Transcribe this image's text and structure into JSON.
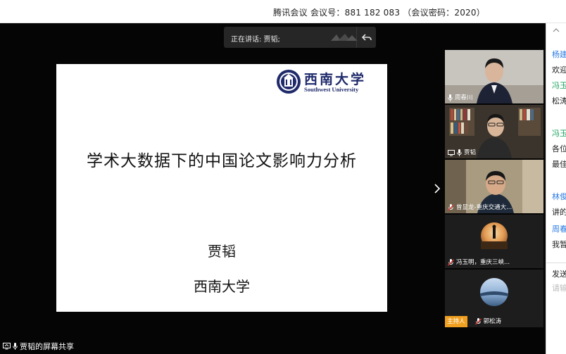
{
  "titlebar": {
    "text": "腾讯会议  会议号：881 182 083 （会议密码：2020）"
  },
  "speaking": {
    "label": "正在讲话: 贾韬;"
  },
  "slide": {
    "logo_cn": "西南大学",
    "logo_en": "Southwest University",
    "title": "学术大数据下的中国论文影响力分析",
    "author": "贾韬",
    "org": "西南大学"
  },
  "participants": [
    {
      "name": "周春川",
      "icon": "mic-icon"
    },
    {
      "name": "贾韬",
      "icon": "screen-share-icon"
    },
    {
      "name": "曾显龙-重庆交通大...",
      "icon": "mic-muted-icon"
    },
    {
      "name": "冯玉明，重庆三峡...",
      "icon": "mic-muted-icon"
    },
    {
      "name": "郭松涛",
      "host_badge": "主持人",
      "icon": "mic-muted-icon"
    }
  ],
  "screen_share_label": "贾韬的屏幕共享",
  "chat": [
    {
      "text": "杨建",
      "color": "blue"
    },
    {
      "text": "欢迎",
      "color": "dark"
    },
    {
      "text": "冯玉",
      "color": "green"
    },
    {
      "text": "松涛",
      "color": "dark"
    },
    {
      "text": "冯玉",
      "color": "green"
    },
    {
      "text": "各位",
      "color": "dark"
    },
    {
      "text": "最佳",
      "color": "dark"
    },
    {
      "text": "林俊",
      "color": "blue"
    },
    {
      "text": "讲的",
      "color": "dark"
    },
    {
      "text": "周春",
      "color": "blue"
    },
    {
      "text": "我暂",
      "color": "dark"
    }
  ],
  "chat_send_label": "发送",
  "chat_input_placeholder": "请输",
  "colors": {
    "stage_bg": "#050505",
    "host_badge": "#f0a020",
    "chat_blue": "#2a7ae2",
    "chat_green": "#1aa05b"
  }
}
